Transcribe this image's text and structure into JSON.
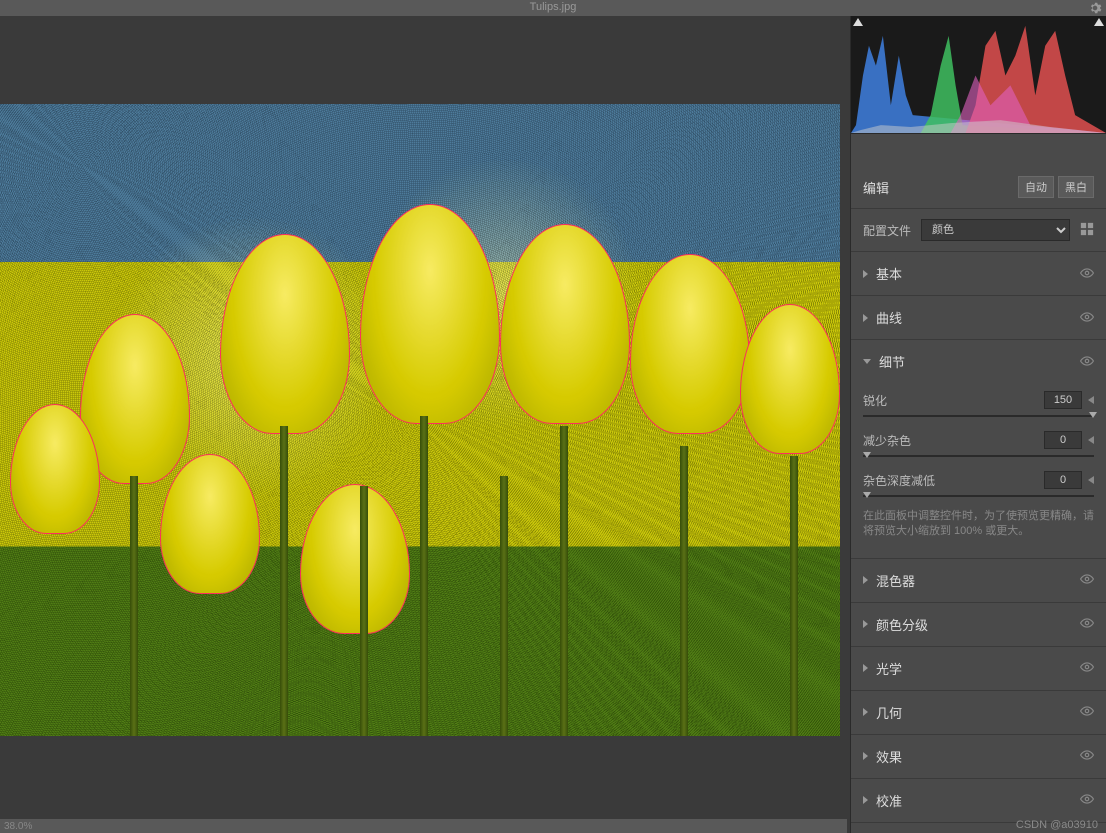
{
  "file_title": "Tulips.jpg",
  "edit": {
    "title": "编辑",
    "auto_btn": "自动",
    "bw_btn": "黑白"
  },
  "profile": {
    "label": "配置文件",
    "value": "颜色"
  },
  "panels": {
    "basic": "基本",
    "curves": "曲线",
    "detail": "细节",
    "mixer": "混色器",
    "grading": "颜色分级",
    "optics": "光学",
    "geometry": "几何",
    "effects": "效果",
    "calibration": "校准"
  },
  "detail": {
    "sharpen_label": "锐化",
    "sharpen_value": "150",
    "noise_label": "减少杂色",
    "noise_value": "0",
    "color_noise_label": "杂色深度减低",
    "color_noise_value": "0",
    "hint": "在此面板中调整控件时，为了使预览更精确，请将预览大小缩放到 100% 或更大。"
  },
  "watermark": "CSDN @a03910",
  "zoom_text": "38.0%"
}
